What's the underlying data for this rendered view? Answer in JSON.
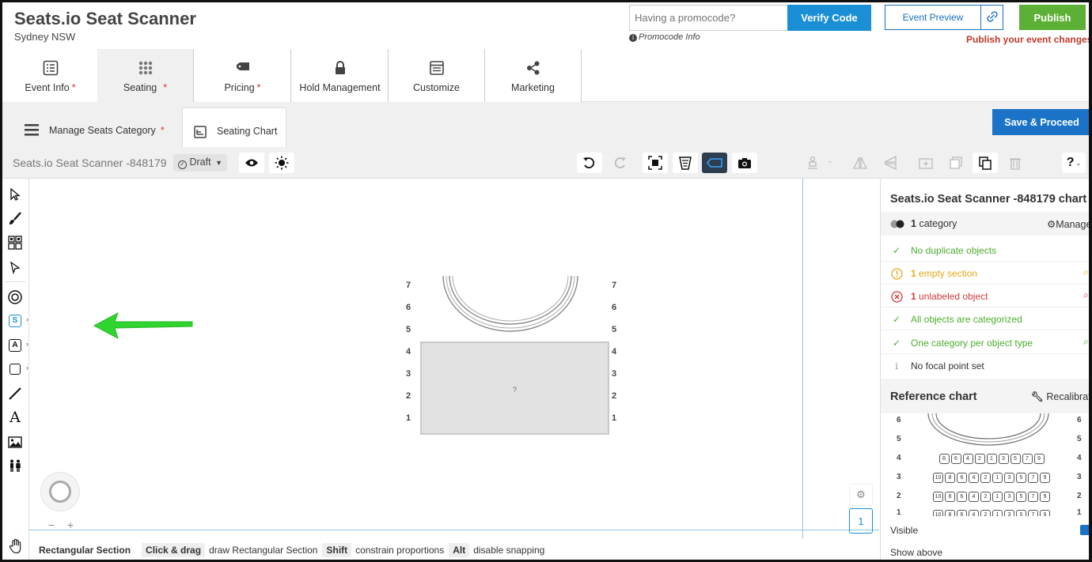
{
  "header": {
    "title": "Seats.io Seat Scanner",
    "location": "Sydney NSW",
    "promo_placeholder": "Having a promocode?",
    "verify_label": "Verify Code",
    "promo_info": "Promocode Info",
    "preview_label": "Event Preview",
    "publish_label": "Publish",
    "publish_warning": "Publish your event changes."
  },
  "tabs": [
    {
      "label": "Event Info",
      "star": "*"
    },
    {
      "label": "Seating",
      "star": "*"
    },
    {
      "label": "Pricing",
      "star": "*"
    },
    {
      "label": "Hold Management",
      "star": ""
    },
    {
      "label": "Customize",
      "star": ""
    },
    {
      "label": "Marketing",
      "star": ""
    }
  ],
  "subtabs": {
    "manage": "Manage Seats Category",
    "manage_star": "*",
    "chart": "Seating Chart",
    "save_label": "Save & Proceed"
  },
  "toolbar": {
    "chart_name": "Seats.io Seat Scanner -848179",
    "status": "Draft",
    "help": "?"
  },
  "canvas": {
    "row_numbers": [
      "7",
      "6",
      "5",
      "4",
      "3",
      "2",
      "1"
    ],
    "section_label": "?",
    "page_number": "1"
  },
  "hint": {
    "mode": "Rectangular Section",
    "k1": "Click & drag",
    "d1": "draw Rectangular Section",
    "k2": "Shift",
    "d2": "constrain proportions",
    "k3": "Alt",
    "d3": "disable snapping"
  },
  "panel": {
    "title": "Seats.io Seat Scanner -848179 chart",
    "category_count": "1",
    "category_label": "category",
    "manage": "Manage",
    "checks": [
      {
        "count": "",
        "text": "No duplicate objects",
        "status": "ok"
      },
      {
        "count": "1",
        "text": "empty section",
        "status": "warn"
      },
      {
        "count": "1",
        "text": "unlabeled object",
        "status": "error"
      },
      {
        "count": "",
        "text": "All objects are categorized",
        "status": "ok"
      },
      {
        "count": "",
        "text": "One category per object type",
        "status": "ok"
      },
      {
        "count": "",
        "text": "No focal point set",
        "status": "info"
      }
    ],
    "reference_title": "Reference chart",
    "recalibrate": "Recalibrate",
    "ref_rows": [
      "6",
      "5",
      "4",
      "3",
      "2",
      "1"
    ],
    "ref_seats_row4": [
      "8",
      "6",
      "4",
      "2",
      "1",
      "3",
      "5",
      "7",
      "9"
    ],
    "ref_seats_row3": [
      "10",
      "8",
      "6",
      "4",
      "2",
      "1",
      "3",
      "5",
      "7",
      "9"
    ],
    "ref_seats_row2": [
      "10",
      "8",
      "6",
      "4",
      "2",
      "1",
      "3",
      "5",
      "7",
      "9"
    ],
    "visible_label": "Visible",
    "show_above_label": "Show above"
  },
  "colors": {
    "accent": "#1a8fd6",
    "publish": "#5cb035",
    "warning": "#e6a817",
    "error": "#d23b3b",
    "ok": "#4cae2e"
  }
}
